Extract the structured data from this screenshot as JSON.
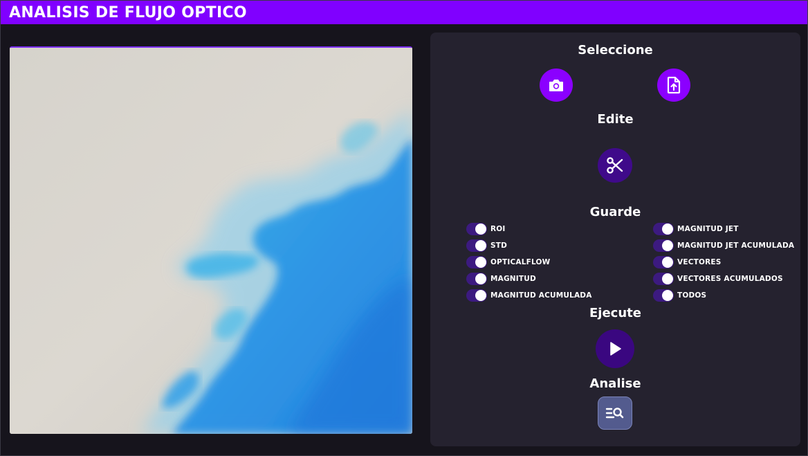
{
  "header": {
    "title": "ANALISIS DE FLUJO OPTICO"
  },
  "colors": {
    "accent": "#8000ff",
    "panel": "#25222f",
    "background": "#16141c"
  },
  "sections": {
    "select": "Seleccione",
    "edit": "Edite",
    "save": "Guarde",
    "execute": "Ejecute",
    "analyze": "Analise"
  },
  "icons": {
    "camera": "camera-icon",
    "upload": "file-upload-icon",
    "cut": "scissors-icon",
    "play": "play-icon",
    "analyze": "list-search-icon"
  },
  "options_left": [
    {
      "label": "ROI",
      "on": true
    },
    {
      "label": "STD",
      "on": true
    },
    {
      "label": "OPTICALFLOW",
      "on": true
    },
    {
      "label": "MAGNITUD",
      "on": true
    },
    {
      "label": "MAGNITUD ACUMULADA",
      "on": true
    }
  ],
  "options_right": [
    {
      "label": "MAGNITUD JET",
      "on": true
    },
    {
      "label": "MAGNITUD JET ACUMULADA",
      "on": true
    },
    {
      "label": "VECTORES",
      "on": true
    },
    {
      "label": "VECTORES ACUMULADOS",
      "on": true
    },
    {
      "label": "TODOS",
      "on": true
    }
  ]
}
